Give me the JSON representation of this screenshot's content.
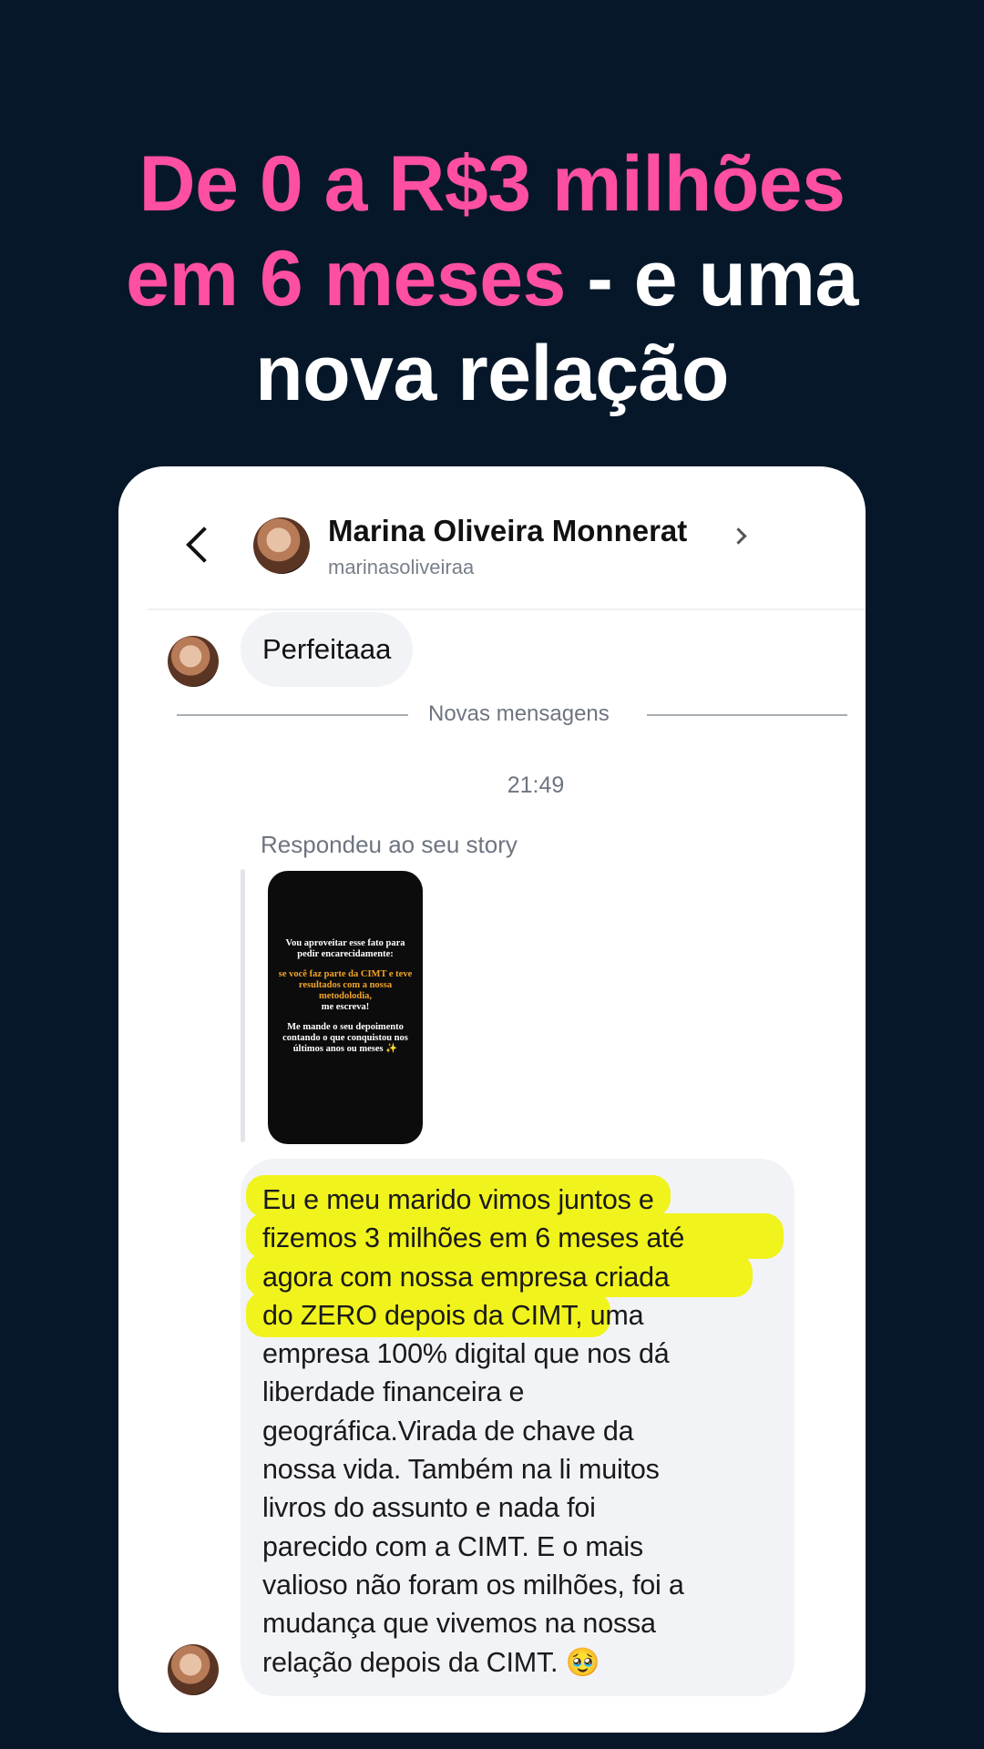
{
  "headline": {
    "pink_line1": "De 0 a R$3 milhões",
    "pink_line2": "em 6 meses",
    "white_line2": " - e uma",
    "white_line3": "nova relação"
  },
  "chat": {
    "contact_name": "Marina Oliveira Monnerat",
    "contact_handle": "marinasoliveiraa",
    "first_message": "Perfeitaaa",
    "divider_label": "Novas mensagens",
    "timestamp": "21:49",
    "reply_label": "Respondeu ao seu story",
    "story": {
      "line1": "Vou aproveitar esse fato para pedir encarecidamente:",
      "highlight": "se você faz parte da CIMT e teve resultados com a nossa metodolodia,",
      "line2": "me escreva!",
      "line3": "Me mande o seu depoimento contando o que conquistou nos últimos anos ou meses ✨"
    },
    "message_lines": [
      "Eu e meu marido vimos juntos e",
      "fizemos 3 milhões em 6 meses até",
      "agora com nossa empresa criada",
      "do ZERO depois da CIMT, uma",
      "empresa 100% digital que nos dá",
      "liberdade financeira e",
      "geográfica.Virada de chave da",
      "nossa vida. Também na li muitos",
      "livros do assunto e nada foi",
      "parecido com a CIMT. E o mais",
      "valioso não foram os milhões, foi a",
      "mudança que vivemos na nossa",
      "relação depois da CIMT. 🥹"
    ]
  },
  "colors": {
    "background": "#07172a",
    "accent_pink": "#ff4fa3",
    "highlighter": "#f1f31d",
    "bubble": "#f2f3f6"
  }
}
